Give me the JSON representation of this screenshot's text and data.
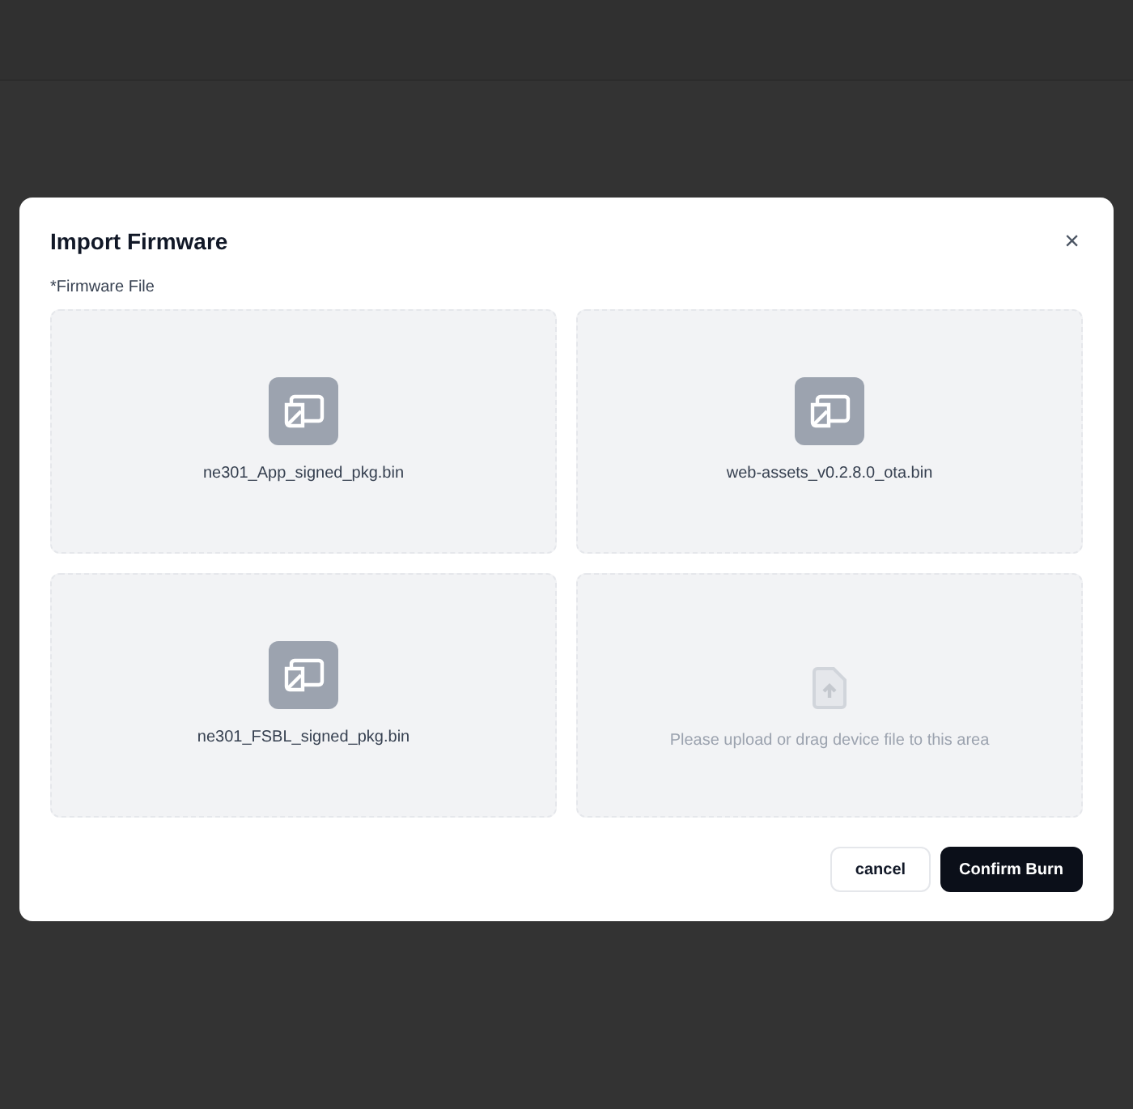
{
  "dialog": {
    "title": "Import Firmware",
    "close": "×",
    "field_label": "*Firmware File",
    "slots": [
      {
        "kind": "file",
        "name": "ne301_App_signed_pkg.bin"
      },
      {
        "kind": "file",
        "name": "web-assets_v0.2.8.0_ota.bin"
      },
      {
        "kind": "file",
        "name": "ne301_FSBL_signed_pkg.bin"
      },
      {
        "kind": "upload",
        "hint": "Please upload or drag device file to this area"
      }
    ],
    "buttons": [
      {
        "kind": "secondary",
        "label": "cancel"
      },
      {
        "kind": "primary",
        "label": "Confirm Burn"
      }
    ]
  }
}
